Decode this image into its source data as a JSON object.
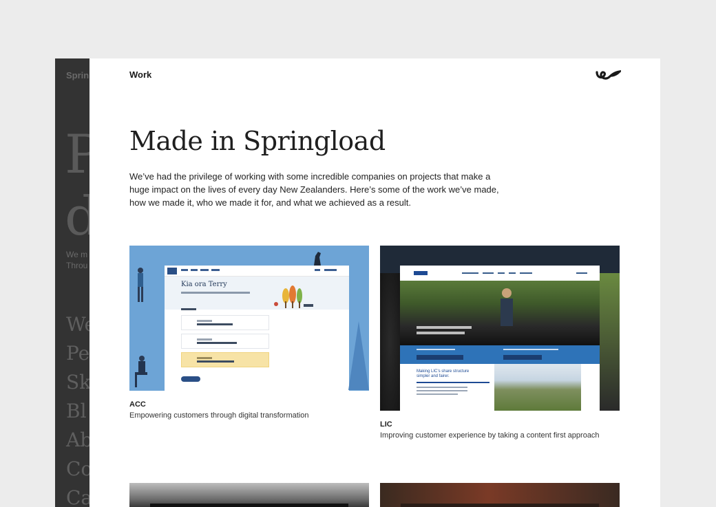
{
  "background_page": {
    "brand": "Sprin",
    "hero_lines": [
      "P",
      "d"
    ],
    "intro_lines": [
      "We m",
      "Throu"
    ],
    "menu": [
      "We",
      "Pe",
      "Sk",
      "Bl",
      "Ab",
      "Co",
      "Ca"
    ]
  },
  "header": {
    "section": "Work",
    "logo_icon": "springload-logo-icon"
  },
  "page": {
    "title": "Made in Springload",
    "intro": "We’ve had the privilege of working with some incredible companies on projects that make a huge impact on the lives of every day New Zealanders. Here’s some of the work we’ve made, how we made it, who we made it for, and what we achieved as a result."
  },
  "projects": [
    {
      "name": "ACC",
      "description": "Empowering customers through digital transformation",
      "thumb": {
        "greeting": "Kia ora Terry"
      }
    },
    {
      "name": "LIC",
      "description": "Improving customer experience by taking a content first approach",
      "thumb": {
        "headline": "Making LIC’s share structure simpler and fairer."
      }
    }
  ],
  "colors": {
    "acc_blue": "#6da4d6",
    "lic_blue": "#2e73b8",
    "dark_page": "#333333"
  }
}
